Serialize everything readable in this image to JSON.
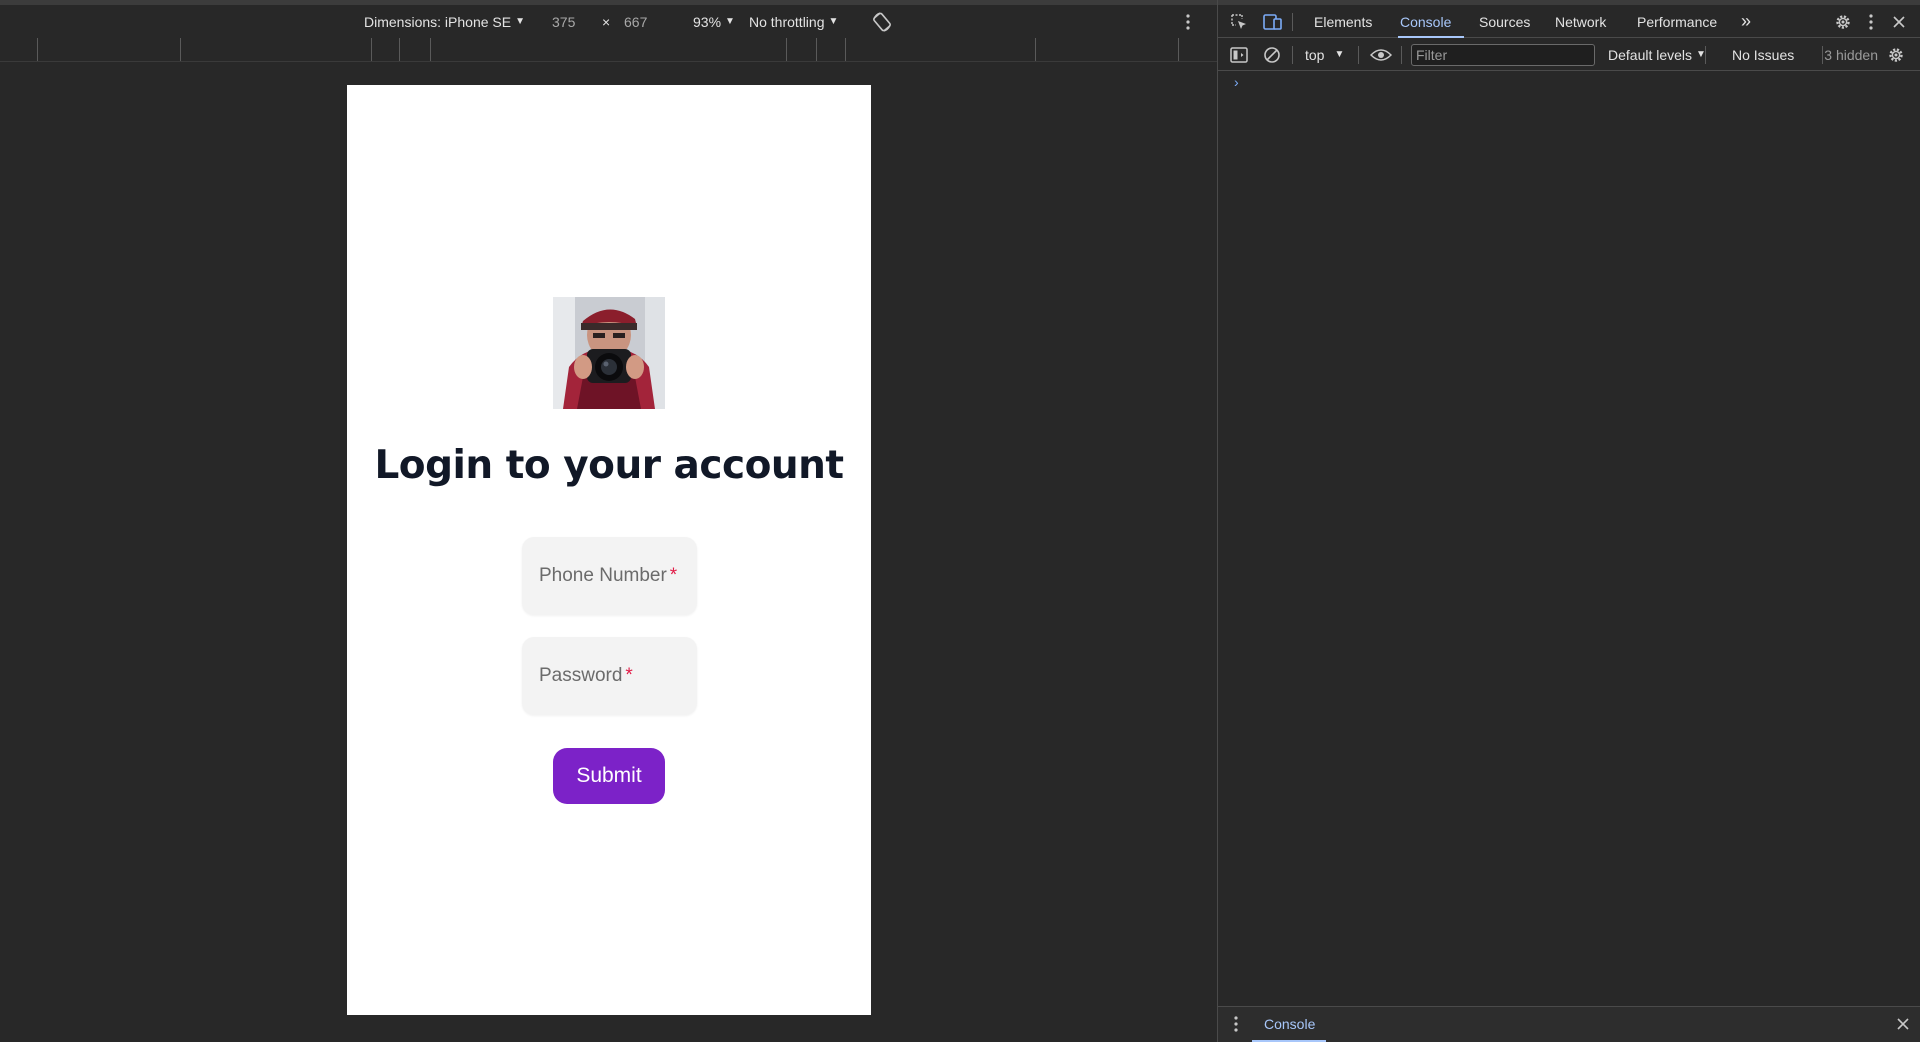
{
  "device_toolbar": {
    "dimensions_label": "Dimensions: iPhone SE",
    "width_value": "375",
    "times": "×",
    "height_value": "667",
    "zoom": "93%",
    "throttling": "No throttling"
  },
  "page": {
    "title": "Login to your account",
    "phone_placeholder": "Phone Number",
    "password_placeholder": "Password",
    "required_mark": "*",
    "submit_label": "Submit"
  },
  "devtools": {
    "tabs": [
      "Elements",
      "Console",
      "Sources",
      "Network",
      "Performance"
    ],
    "active_tab": "Console",
    "more_tabs_glyph": "»",
    "console_toolbar": {
      "context": "top",
      "filter_placeholder": "Filter",
      "levels": "Default levels",
      "issues": "No Issues",
      "hidden": "3 hidden"
    },
    "prompt_glyph": "›",
    "drawer_tab": "Console"
  },
  "colors": {
    "accent": "#7c22c8",
    "devtools_bg": "#282828",
    "active_tab": "#a8c7fa",
    "required": "#e11d48"
  },
  "icons": [
    "rotate-icon",
    "kebab-menu-icon",
    "inspect-element-icon",
    "device-toggle-icon",
    "more-tabs-icon",
    "settings-gear-icon",
    "close-icon",
    "sidebar-toggle-icon",
    "clear-console-icon",
    "live-expression-eye-icon",
    "caret-down-icon",
    "avatar-photo"
  ]
}
